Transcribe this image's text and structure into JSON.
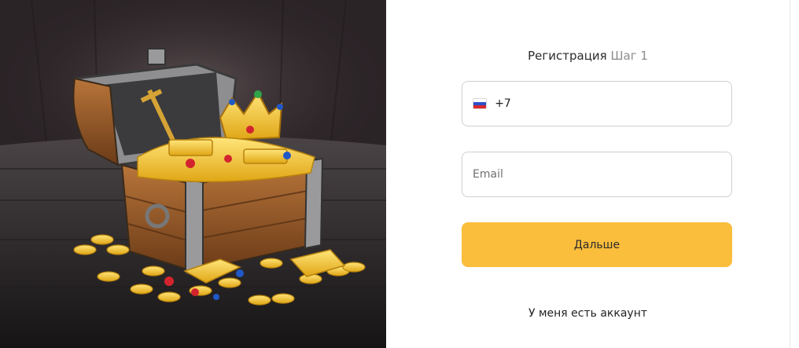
{
  "colors": {
    "accent": "#fbbd3c",
    "border": "#cfcfcf",
    "text": "#2b2b2b",
    "muted": "#8c8c8c"
  },
  "illustration": {
    "icon": "treasure-chest-illustration"
  },
  "form": {
    "title": "Регистрация",
    "step": "Шаг 1",
    "phone": {
      "flag_icon": "russia-flag-icon",
      "country_code": "+7",
      "value": ""
    },
    "email": {
      "placeholder": "Email",
      "value": ""
    },
    "next_label": "Дальше",
    "login_link": "У меня есть аккаунт"
  }
}
